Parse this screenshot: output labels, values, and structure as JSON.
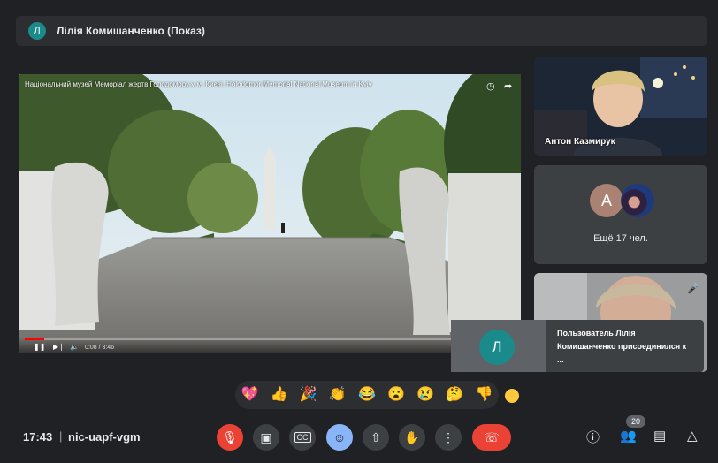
{
  "header": {
    "avatar_letter": "Л",
    "title": "Лілія Комишанченко (Показ)"
  },
  "presentation": {
    "caption": "Національний музей Меморіал жертв Голодомору у м. Києві. Holodomor Memorial National Museum in Kyiv",
    "time": "0:08 / 3:46",
    "progress_fraction": 0.04
  },
  "participants": {
    "tile1_name": "Антон Казмирук",
    "others_letter": "А",
    "others_label": "Ещё 17 чел."
  },
  "toast": {
    "avatar_letter": "Л",
    "message": "Пользователь Лілія Комишанченко присоединился к ..."
  },
  "reactions": [
    "💖",
    "👍",
    "🎉",
    "👏",
    "😂",
    "😮",
    "😢",
    "🤔",
    "👎"
  ],
  "toolbar": {
    "time": "17:43",
    "separator": "|",
    "meeting_code": "nic-uapf-vgm",
    "people_count": "20"
  },
  "icons": {
    "mic_off": "mic-off-icon",
    "camera": "camera-icon",
    "captions": "captions-icon",
    "emoji": "emoji-icon",
    "present": "present-icon",
    "raise_hand": "raise-hand-icon",
    "more": "more-vert-icon",
    "end_call": "end-call-icon",
    "info": "info-icon",
    "people": "people-icon",
    "chat": "chat-icon",
    "activities": "activities-icon"
  },
  "colors": {
    "background": "#202124",
    "danger": "#ea4335",
    "accent": "#8ab4f8"
  }
}
